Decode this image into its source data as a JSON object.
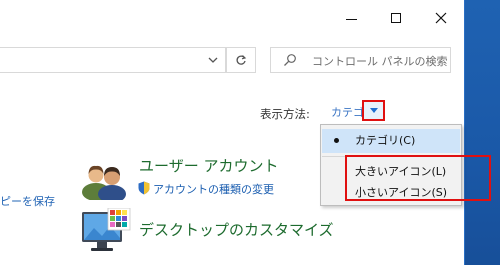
{
  "window": {
    "minimize_label": "minimize",
    "maximize_label": "maximize",
    "close_label": "close"
  },
  "toolbar": {
    "search_placeholder": "コントロール パネルの検索"
  },
  "view_by": {
    "label": "表示方法:",
    "current": "カテゴリ"
  },
  "view_menu": {
    "items": [
      {
        "label": "カテゴリ(C)",
        "selected": true
      },
      {
        "label": "大きいアイコン(L)",
        "selected": false
      },
      {
        "label": "小さいアイコン(S)",
        "selected": false
      }
    ]
  },
  "left_partial_link": "ピーを保存",
  "categories": {
    "user_accounts": {
      "title": "ユーザー アカウント",
      "sub_link": "アカウントの種類の変更"
    },
    "desktop": {
      "title": "デスクトップのカスタマイズ"
    }
  },
  "colors": {
    "accent_red": "#e01010",
    "link_blue": "#1b5eb0",
    "category_green": "#1d6b2e",
    "menu_selected": "#cfe4f9",
    "desktop_blue": "#1b5fae"
  },
  "icons": {
    "search": "search-icon",
    "refresh": "refresh-icon",
    "dropdown": "chevron-down-icon",
    "shield": "uac-shield-icon",
    "users": "users-icon",
    "monitor": "monitor-icon"
  }
}
